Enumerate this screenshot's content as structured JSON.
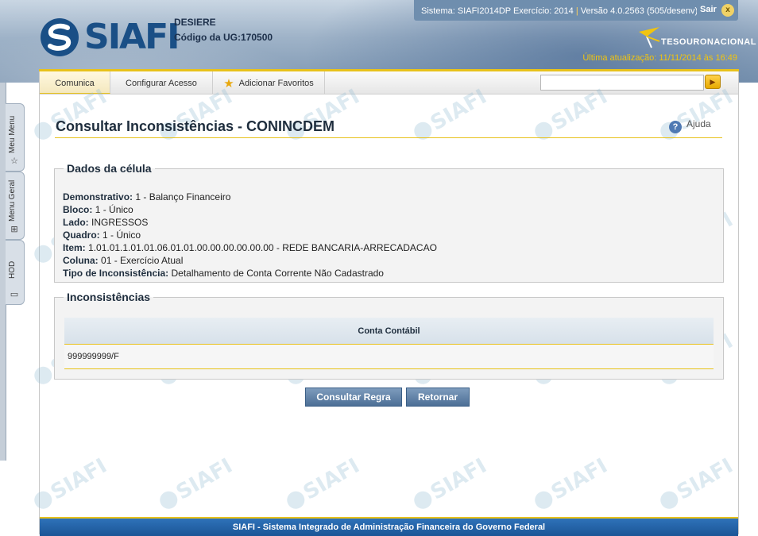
{
  "header": {
    "logo_text": "SIAFI",
    "user_name": "DESIERE",
    "ug_label": "Código da UG:",
    "ug_code": "170500",
    "system_info": "Sistema: SIAFI2014DP Exercício: 2014",
    "separator": "|",
    "version_info": "Versão 4.0.2563 (505/desenv)",
    "logout_label": "Sair",
    "logout_icon": "x",
    "tesouro_label": "TESOURONACIONAL",
    "last_update": "Última atualização: 11/11/2014 às 16:49"
  },
  "side_tabs": [
    {
      "label": "Meu Menu",
      "icon": "star-icon"
    },
    {
      "label": "Menu Geral",
      "icon": "sitemap-icon"
    },
    {
      "label": "HOD",
      "icon": "monitor-icon"
    }
  ],
  "toolbar": {
    "items": [
      "Comunica",
      "Configurar Acesso",
      "Adicionar Favoritos"
    ],
    "search_value": "",
    "go_icon": "▶"
  },
  "page": {
    "title": "Consultar Inconsistências - CONINCDEM",
    "help_label": "Ajuda",
    "help_icon": "?"
  },
  "dados": {
    "legend": "Dados da célula",
    "fields": [
      {
        "label": "Demonstrativo:",
        "value": "1 - Balanço Financeiro"
      },
      {
        "label": "Bloco:",
        "value": "1 - Único"
      },
      {
        "label": "Lado:",
        "value": "INGRESSOS"
      },
      {
        "label": "Quadro:",
        "value": "1 - Único"
      },
      {
        "label": "Item:",
        "value": "1.01.01.1.01.01.06.01.01.00.00.00.00.00.00 - REDE BANCARIA-ARRECADACAO"
      },
      {
        "label": "Coluna:",
        "value": "01 - Exercício Atual"
      },
      {
        "label": "Tipo de Inconsistência:",
        "value": "Detalhamento de Conta Corrente Não Cadastrado"
      }
    ]
  },
  "inconsistencias": {
    "legend": "Inconsistências",
    "column_header": "Conta Contábil",
    "rows": [
      "999999999/F"
    ]
  },
  "buttons": {
    "consultar": "Consultar Regra",
    "retornar": "Retornar"
  },
  "footer": {
    "text": "SIAFI - Sistema Integrado de Administração Financeira do Governo Federal"
  },
  "colors": {
    "accent_yellow": "#e8c21b",
    "brand_blue": "#1b5596",
    "button_blue": "#4c6f96"
  }
}
